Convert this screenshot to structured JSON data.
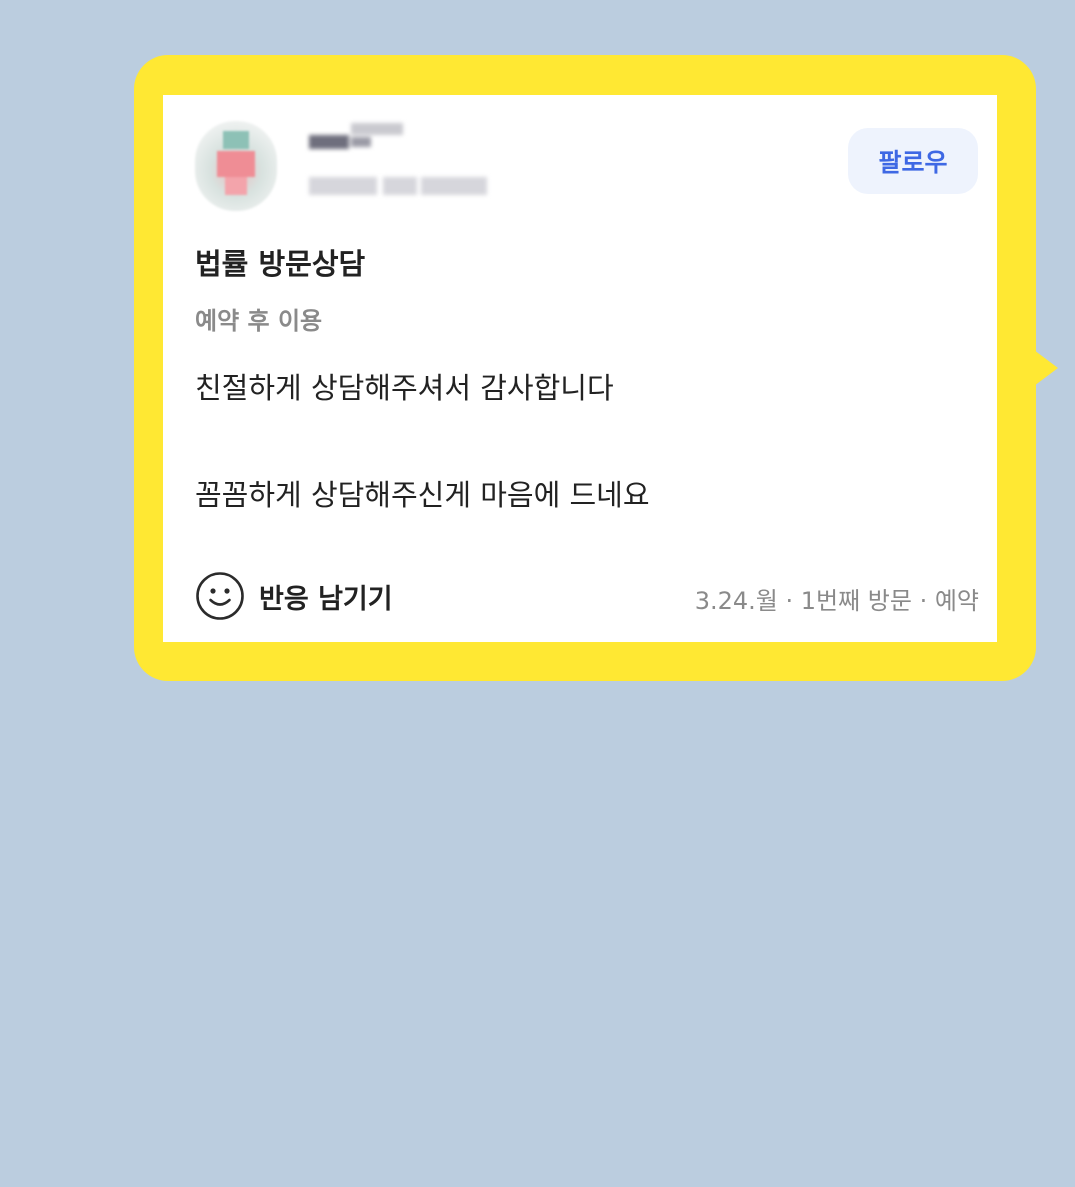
{
  "colors": {
    "background": "#bbcddf",
    "bubble": "#ffe833",
    "card": "#ffffff",
    "follow_text": "#3e68e4",
    "follow_bg": "#eef3fd"
  },
  "review": {
    "follow_label": "팔로우",
    "title": "법률 방문상담",
    "subtitle": "예약 후 이용",
    "body_lines": [
      "친절하게 상담해주셔서 감사합니다",
      "꼼꼼하게 상담해주신게 마음에 드네요"
    ],
    "reaction_icon": "smiley-icon",
    "reaction_label": "반응 남기기",
    "meta": "3.24.월 · 1번째 방문 · 예약"
  }
}
